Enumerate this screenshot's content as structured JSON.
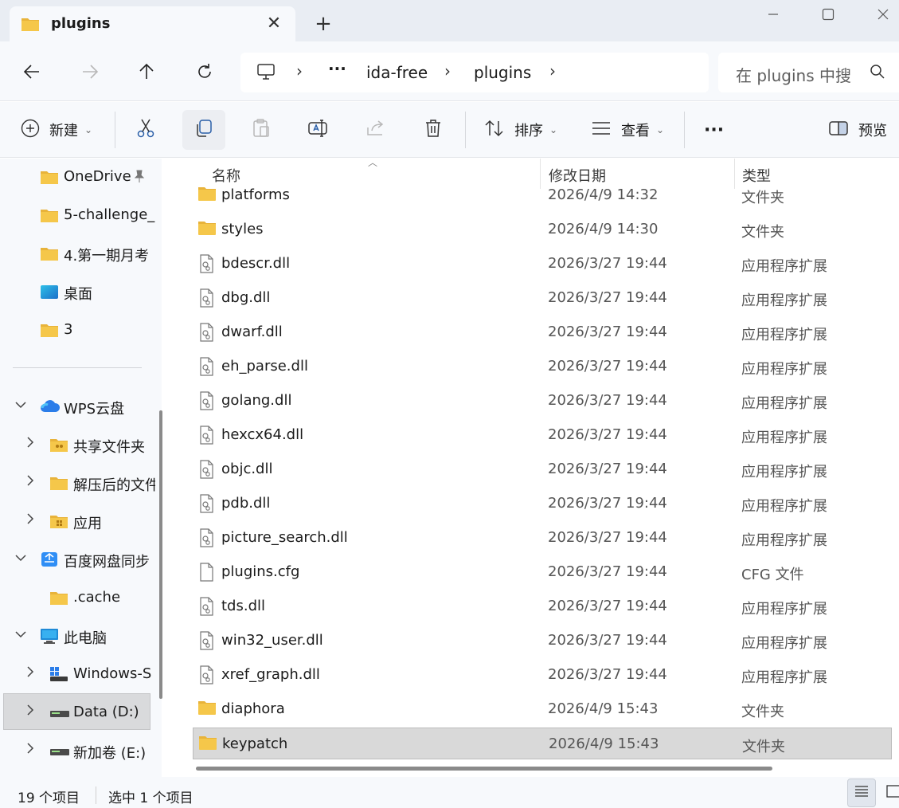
{
  "tab": {
    "title": "plugins",
    "close_glyph": "✕",
    "new_tab_glyph": "+"
  },
  "window_controls": {
    "minimize": "minimize-icon",
    "maximize": "maximize-icon",
    "close": "close-icon"
  },
  "nav": {
    "back": "arrow-left-icon",
    "forward": "arrow-right-icon",
    "up": "arrow-up-icon",
    "refresh": "refresh-icon"
  },
  "address": {
    "more": "···",
    "crumbs": [
      "ida-free",
      "plugins"
    ],
    "separator": "›"
  },
  "search": {
    "placeholder": "在 plugins 中搜"
  },
  "toolbar": {
    "new_label": "新建",
    "sort_label": "排序",
    "view_label": "查看",
    "more_label": "···",
    "preview_label": "预览"
  },
  "sidebar": {
    "quick": [
      {
        "label": "OneDrive",
        "pinned": true
      },
      {
        "label": "5-challenge_"
      },
      {
        "label": "4.第一期月考"
      },
      {
        "label": "桌面"
      },
      {
        "label": "3"
      }
    ],
    "tree": [
      {
        "label": "WPS云盘",
        "expander": "⌄",
        "level": 0
      },
      {
        "label": "共享文件夹",
        "expander": "›",
        "level": 1
      },
      {
        "label": "解压后的文件",
        "expander": "›",
        "level": 1
      },
      {
        "label": "应用",
        "expander": "›",
        "level": 1
      },
      {
        "label": "百度网盘同步",
        "expander": "⌄",
        "level": 0
      },
      {
        "label": ".cache",
        "expander": "",
        "level": 1
      },
      {
        "label": "此电脑",
        "expander": "⌄",
        "level": 0
      },
      {
        "label": "Windows-S",
        "expander": "›",
        "level": 1
      },
      {
        "label": "Data (D:)",
        "expander": "›",
        "level": 1,
        "selected": true
      },
      {
        "label": "新加卷 (E:)",
        "expander": "›",
        "level": 1
      }
    ]
  },
  "columns": {
    "name": "名称",
    "date": "修改日期",
    "type": "类型"
  },
  "files": [
    {
      "name": "platforms",
      "date": "2026/4/9 14:32",
      "type": "文件夹",
      "kind": "folder"
    },
    {
      "name": "styles",
      "date": "2026/4/9 14:30",
      "type": "文件夹",
      "kind": "folder"
    },
    {
      "name": "bdescr.dll",
      "date": "2026/3/27 19:44",
      "type": "应用程序扩展",
      "kind": "dll"
    },
    {
      "name": "dbg.dll",
      "date": "2026/3/27 19:44",
      "type": "应用程序扩展",
      "kind": "dll"
    },
    {
      "name": "dwarf.dll",
      "date": "2026/3/27 19:44",
      "type": "应用程序扩展",
      "kind": "dll"
    },
    {
      "name": "eh_parse.dll",
      "date": "2026/3/27 19:44",
      "type": "应用程序扩展",
      "kind": "dll"
    },
    {
      "name": "golang.dll",
      "date": "2026/3/27 19:44",
      "type": "应用程序扩展",
      "kind": "dll"
    },
    {
      "name": "hexcx64.dll",
      "date": "2026/3/27 19:44",
      "type": "应用程序扩展",
      "kind": "dll"
    },
    {
      "name": "objc.dll",
      "date": "2026/3/27 19:44",
      "type": "应用程序扩展",
      "kind": "dll"
    },
    {
      "name": "pdb.dll",
      "date": "2026/3/27 19:44",
      "type": "应用程序扩展",
      "kind": "dll"
    },
    {
      "name": "picture_search.dll",
      "date": "2026/3/27 19:44",
      "type": "应用程序扩展",
      "kind": "dll"
    },
    {
      "name": "plugins.cfg",
      "date": "2026/3/27 19:44",
      "type": "CFG 文件",
      "kind": "file"
    },
    {
      "name": "tds.dll",
      "date": "2026/3/27 19:44",
      "type": "应用程序扩展",
      "kind": "dll"
    },
    {
      "name": "win32_user.dll",
      "date": "2026/3/27 19:44",
      "type": "应用程序扩展",
      "kind": "dll"
    },
    {
      "name": "xref_graph.dll",
      "date": "2026/3/27 19:44",
      "type": "应用程序扩展",
      "kind": "dll"
    },
    {
      "name": "diaphora",
      "date": "2026/4/9 15:43",
      "type": "文件夹",
      "kind": "folder"
    },
    {
      "name": "keypatch",
      "date": "2026/4/9 15:43",
      "type": "文件夹",
      "kind": "folder",
      "selected": true
    }
  ],
  "status": {
    "item_count": "19 个项目",
    "selected_count": "选中 1 个项目"
  },
  "colors": {
    "folder": "#f5c74a",
    "folder_dark": "#e8b33a",
    "selection": "#d9d9d9",
    "chrome": "#f7f9fc",
    "tabbar": "#e9edf3"
  }
}
